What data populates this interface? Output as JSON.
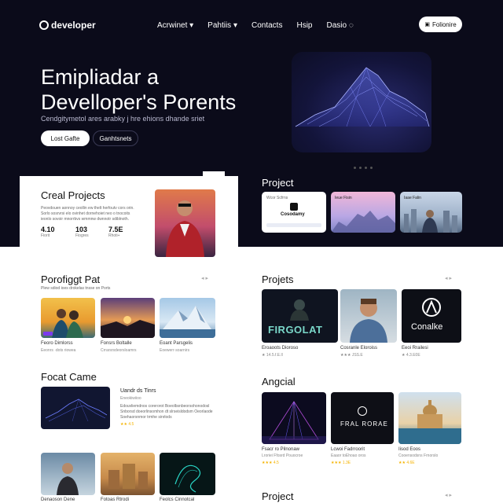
{
  "header": {
    "logo": "developer",
    "nav": [
      "Acrwinet",
      "Pahtiis",
      "Contacts",
      "Hsip",
      "Dasio"
    ],
    "nav_suffix": [
      "▾",
      "▾",
      "",
      "",
      "◌"
    ],
    "cta": "Folionire"
  },
  "hero": {
    "title_line1": "Emipliadar a",
    "title_line2": "Develloper's Porents",
    "subtitle": "Cendgitymetol ares arabky j hre ehions dhande sriet",
    "primary_button": "Lost Gafte",
    "secondary_button": "Ganhtsnets"
  },
  "creal": {
    "title": "Creal Projects",
    "text_lines": [
      "Peovdouen aonnoy ceollin ew thelt herfoutv cors orin.",
      "Sorlo sosrvrsi elo ovinhet dornehoiet neo o tnocoits",
      "ieonlo sovoir mnorrbvs wmmnw dwnnotr sdiblnoth."
    ],
    "stats": [
      {
        "value": "4.10",
        "label": "Fiorit"
      },
      {
        "value": "103",
        "label": "Fiogres"
      },
      {
        "value": "7.5E",
        "label": "Rhoti+"
      }
    ]
  },
  "projects_top": {
    "title": "Project",
    "cards": [
      {
        "name": "Cosodamy",
        "top": "Wcor Scfrns"
      },
      {
        "name": "Ieue Fisin",
        "top": "Ieue Fisin"
      },
      {
        "name": "Iaae Falin",
        "top": "Iaae Falin"
      }
    ]
  },
  "portfolio": {
    "title": "Porofiggt Pat",
    "subtitle": "Plew sdiod ioes drokelas tnsse on Ports",
    "controls": "◂ ▸",
    "items": [
      {
        "caption": "Feoro Dimlorss",
        "meta": "Eeonrs ·dots riowea"
      },
      {
        "caption": "Fonsrs Boltalle",
        "meta": "Crrarsrsdeorsloamrs"
      },
      {
        "caption": "Eoant Parsgelis",
        "meta": "Eoewerr·soarnirs"
      }
    ]
  },
  "projets": {
    "title": "Projets",
    "controls": "◂ ▸",
    "tile1_text": "FIRGOLAT",
    "tile3_text": "Conalke",
    "items": [
      {
        "caption": "Eroaoots Dioroso",
        "meta": "★ 14.5.f.E.ll"
      },
      {
        "caption": "Cosranle Eloroiss",
        "meta": "★★★ JSS.E"
      },
      {
        "caption": "Eeoi Rrailesi",
        "meta": "★ 4.3.E0E"
      }
    ]
  },
  "focal": {
    "title": "Focat Came",
    "item_title": "Uandr ds Tinrs",
    "item_sub": "Eneokiwiioo",
    "text_lines": [
      "Edouvliemdnos corerorot  Boeolbsnbeorsohonodosl",
      "Snborsd doeorlinsomhon dt slrseisldodsm Oeorlaode",
      "Soehaorsnmor trmhe sinrlods"
    ],
    "rating": "★★ 4.5"
  },
  "angcial": {
    "title": "Angcial",
    "tile2_text": "FRAL RORAE",
    "items": [
      {
        "caption": "Fsacr ro Pilnonaw",
        "meta": "Lroriei Ffosrd Pouocroe"
      },
      {
        "caption": "Lcwoi Fadrroorit",
        "meta": "Eaaor toEhoao oros"
      },
      {
        "caption": "Iisod Eoos",
        "meta": "Cooensodsns Frnorslo"
      }
    ],
    "ratings": [
      "★★★ 4.5",
      "★★★ 1.3E",
      "★★ 4.6E"
    ]
  },
  "bottom_row": {
    "items": [
      {
        "caption": "Denaoson Dene"
      },
      {
        "caption": "Fotoas Rtrodi"
      },
      {
        "caption": "Feolcs Cinnotcal"
      }
    ]
  },
  "project_bottom": {
    "title": "Project",
    "controls": "◂ ▸"
  },
  "colors": {
    "hero_bg": "#0b0b1a",
    "accent": "#7c3aed",
    "star": "#f5b301"
  }
}
